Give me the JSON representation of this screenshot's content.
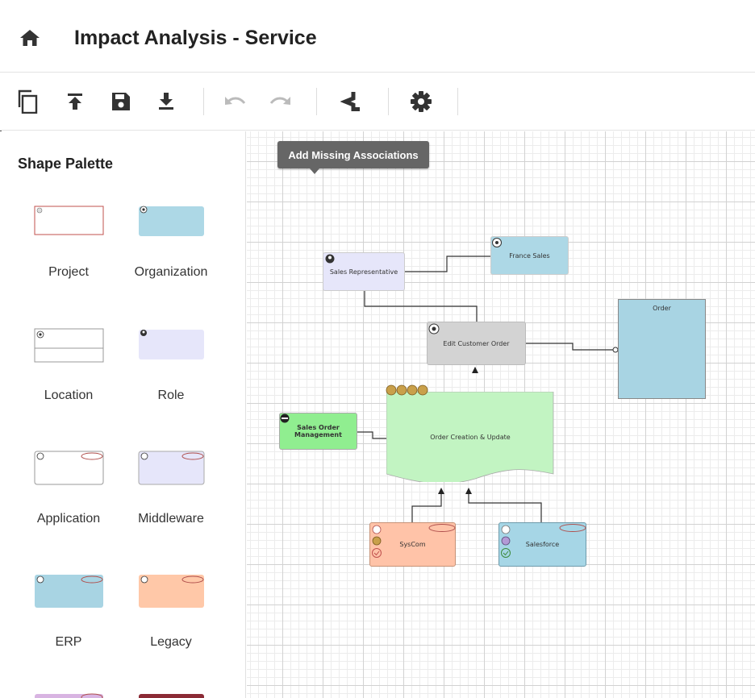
{
  "header": {
    "title": "Impact Analysis - Service"
  },
  "toolbar": {
    "buttons": [
      "copy-icon",
      "upload-icon",
      "save-icon",
      "download-icon",
      "undo-icon",
      "redo-icon",
      "share-icon",
      "settings-icon"
    ]
  },
  "palette": {
    "title": "Shape Palette",
    "items": [
      {
        "label": "Project",
        "color": "#ffffff",
        "border": "#c0504d"
      },
      {
        "label": "Organization",
        "color": "#add8e6"
      },
      {
        "label": "Location",
        "color": "#ffffff"
      },
      {
        "label": "Role",
        "color": "#e6e6fa"
      },
      {
        "label": "Application",
        "color": "#ffffff"
      },
      {
        "label": "Middleware",
        "color": "#e6e6fa"
      },
      {
        "label": "ERP",
        "color": "#a8d4e3"
      },
      {
        "label": "Legacy",
        "color": "#ffc8a8"
      }
    ]
  },
  "canvas": {
    "action_button": "Add Missing Associations",
    "nodes": {
      "sales_rep": "Sales Representative",
      "france_sales": "France Sales",
      "edit_order": "Edit Customer Order",
      "order": "Order",
      "som": "Sales Order Management",
      "ocu": "Order Creation & Update",
      "syscom": "SysCom",
      "salesforce": "Salesforce"
    }
  },
  "colors": {
    "role": "#e6e6fa",
    "org": "#add8e6",
    "process": "#d3d3d3",
    "data": "#a8d4e3",
    "capability": "#90ee90",
    "service": "#c2f4c2",
    "legacy": "#ffc3a8",
    "erp": "#a6d6e6"
  }
}
